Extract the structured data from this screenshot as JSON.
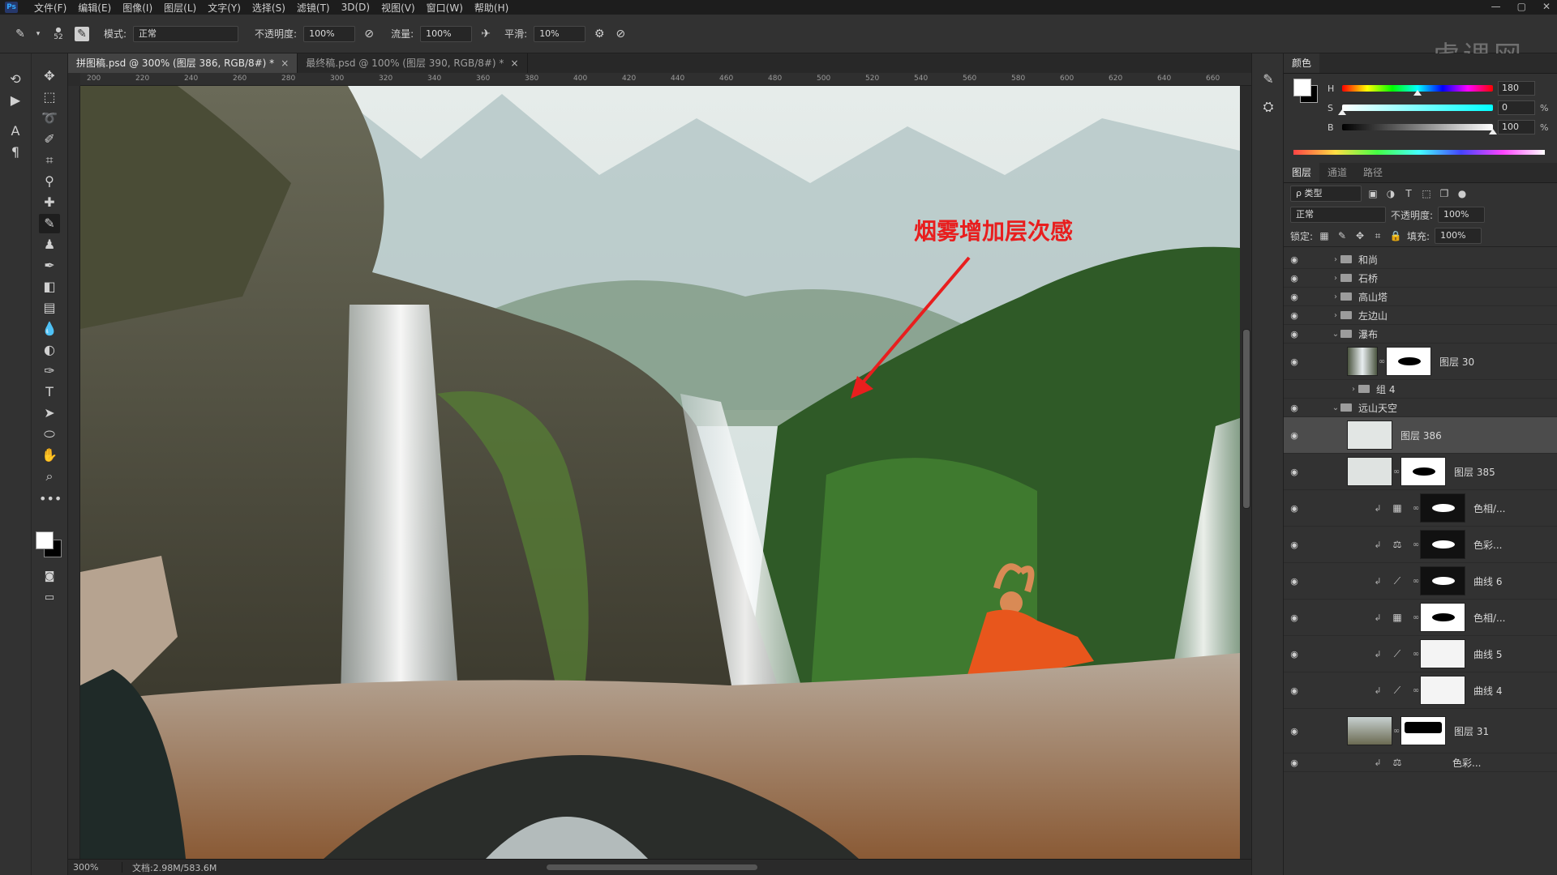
{
  "menu": {
    "items": [
      "文件(F)",
      "编辑(E)",
      "图像(I)",
      "图层(L)",
      "文字(Y)",
      "选择(S)",
      "滤镜(T)",
      "3D(D)",
      "视图(V)",
      "窗口(W)",
      "帮助(H)"
    ],
    "brand": "虎课网"
  },
  "options": {
    "brush_size": "52",
    "mode_label": "模式:",
    "mode_value": "正常",
    "opacity_label": "不透明度:",
    "opacity_value": "100%",
    "flow_label": "流量:",
    "flow_value": "100%",
    "smooth_label": "平滑:",
    "smooth_value": "10%"
  },
  "tabs": [
    {
      "label": "拼图稿.psd @ 300% (图层 386, RGB/8#) *",
      "close": "×"
    },
    {
      "label": "最终稿.psd @ 100% (图层 390, RGB/8#) *",
      "close": "×"
    }
  ],
  "ruler": {
    "ticks": [
      "200",
      "220",
      "240",
      "260",
      "280",
      "300",
      "320",
      "340",
      "360",
      "380",
      "400",
      "420",
      "440",
      "460",
      "480",
      "500",
      "520",
      "540",
      "560",
      "580",
      "600",
      "620",
      "640",
      "660"
    ]
  },
  "canvas": {
    "annotation": "烟雾增加层次感",
    "annotation_color": "#e81e1e"
  },
  "status": {
    "zoom": "300%",
    "doc": "文档:2.98M/583.6M"
  },
  "color_panel": {
    "title": "颜色",
    "h_label": "H",
    "h_value": "180",
    "h_fraction": 0.5,
    "s_label": "S",
    "s_value": "0",
    "s_fraction": 0.0,
    "b_label": "B",
    "b_value": "100",
    "b_fraction": 1.0,
    "pct": "%"
  },
  "layers_panel": {
    "tabs": [
      "图层",
      "通道",
      "路径"
    ],
    "filter": "ρ 类型",
    "blend": "正常",
    "opacity_label": "不透明度:",
    "opacity_value": "100%",
    "lock_label": "锁定:",
    "fill_label": "填充:",
    "fill_value": "100%",
    "layers": [
      {
        "name": "和尚",
        "kind": "group"
      },
      {
        "name": "石桥",
        "kind": "group"
      },
      {
        "name": "高山塔",
        "kind": "group"
      },
      {
        "name": "左边山",
        "kind": "group"
      },
      {
        "name": "瀑布",
        "kind": "group-open"
      },
      {
        "name": "图层 30",
        "kind": "image-mask"
      },
      {
        "name": "组 4",
        "kind": "subgroup"
      },
      {
        "name": "远山天空",
        "kind": "group-open"
      },
      {
        "name": "图层 386",
        "kind": "image-selected"
      },
      {
        "name": "图层 385",
        "kind": "image-mask"
      },
      {
        "name": "色相/...",
        "kind": "adjust"
      },
      {
        "name": "色彩...",
        "kind": "adjust"
      },
      {
        "name": "曲线 6",
        "kind": "adjust"
      },
      {
        "name": "色相/...",
        "kind": "adjust"
      },
      {
        "name": "曲线 5",
        "kind": "adjust"
      },
      {
        "name": "曲线 4",
        "kind": "adjust"
      },
      {
        "name": "图层 31",
        "kind": "image-mask"
      },
      {
        "name": "色彩...",
        "kind": "adjust"
      }
    ]
  }
}
